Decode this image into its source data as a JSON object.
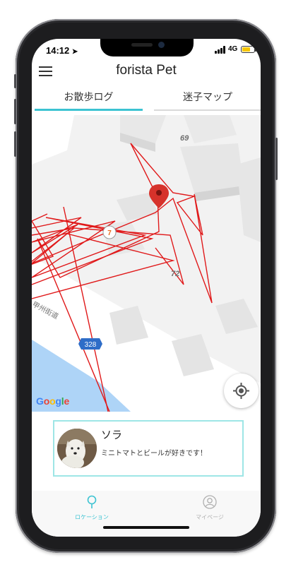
{
  "status_bar": {
    "time": "14:12",
    "network": "4G",
    "battery_color": "#f7c600"
  },
  "header": {
    "menu_icon": "hamburger-icon",
    "title": "forista Pet"
  },
  "tabs": [
    {
      "label": "お散歩ログ",
      "active": true
    },
    {
      "label": "迷子マップ",
      "active": false
    }
  ],
  "map": {
    "labels": {
      "building_69": "69",
      "building_72": "72",
      "road_name": "甲州街道",
      "route_shield": "328",
      "convenience_mark": "7"
    },
    "attribution": {
      "g1": "G",
      "o1": "o",
      "o2": "o",
      "g2": "g",
      "l": "l",
      "e": "e"
    },
    "walk_track_color": "#e0191a",
    "marker_color": "#d6322b",
    "locate_button_icon": "crosshair-icon"
  },
  "profile": {
    "name": "ソラ",
    "description": "ミニトマトとビールが好きです！",
    "border_color": "#9ee6e6"
  },
  "bottom_nav": [
    {
      "label": "ロケーション",
      "icon": "location-pin-icon",
      "active": true
    },
    {
      "label": "マイページ",
      "icon": "user-icon",
      "active": false
    }
  ],
  "colors": {
    "accent": "#3cc3d2"
  }
}
